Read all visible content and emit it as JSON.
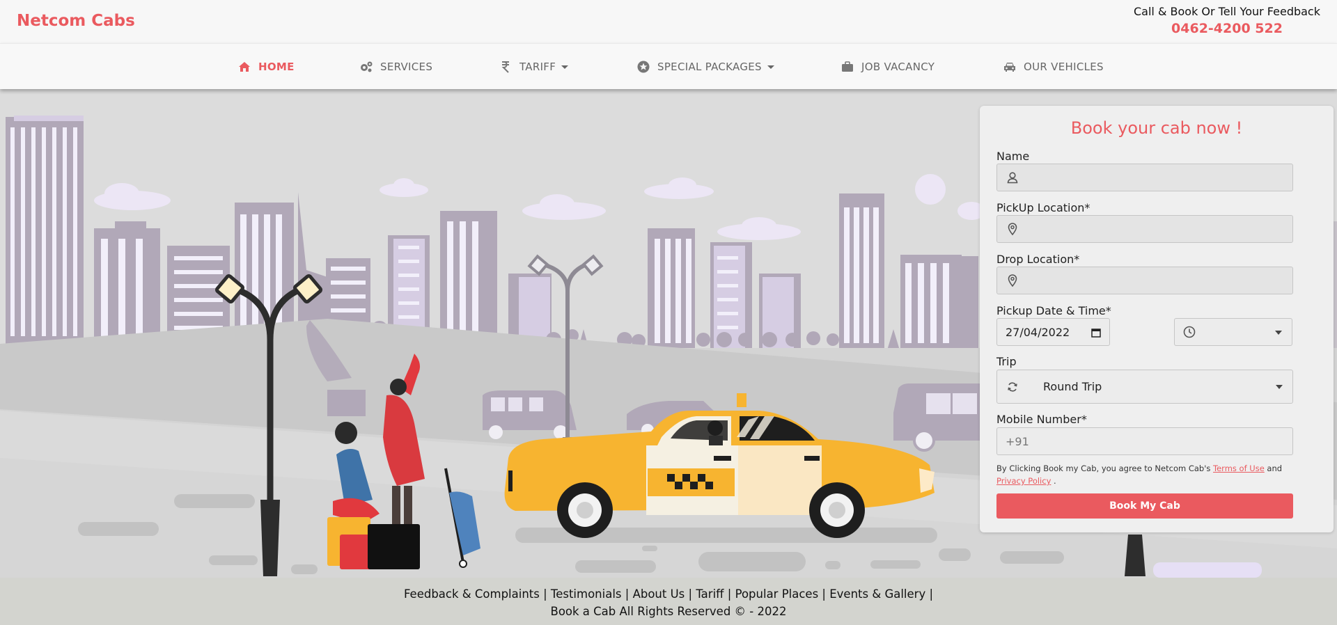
{
  "header": {
    "brand": "Netcom Cabs",
    "contact_line": "Call & Book Or Tell Your Feedback",
    "phone": "0462-4200 522"
  },
  "nav": {
    "items": [
      {
        "label": "HOME",
        "icon": "home-icon",
        "active": true
      },
      {
        "label": "SERVICES",
        "icon": "cogs-icon"
      },
      {
        "label": "TARIFF",
        "icon": "rupee-icon",
        "dropdown": true
      },
      {
        "label": "SPECIAL PACKAGES",
        "icon": "star-icon",
        "dropdown": true
      },
      {
        "label": "JOB VACANCY",
        "icon": "briefcase-icon"
      },
      {
        "label": "OUR VEHICLES",
        "icon": "car-icon"
      }
    ]
  },
  "booking": {
    "title": "Book your cab now !",
    "name_label": "Name",
    "pickup_label": "PickUp Location*",
    "drop_label": "Drop Location*",
    "datetime_label": "Pickup Date & Time*",
    "date_value": "27/04/2022",
    "trip_label": "Trip",
    "trip_value": "Round Trip",
    "mobile_label": "Mobile Number*",
    "mobile_placeholder": "+91",
    "terms_prefix": "By Clicking Book my Cab, you agree to Netcom Cab's ",
    "terms_link": "Terms of Use",
    "terms_and": " and",
    "privacy_link": "Privacy Policy",
    "terms_suffix": " .",
    "button_label": "Book My Cab"
  },
  "footer": {
    "links": [
      "Feedback & Complaints",
      "Testimonials",
      "About Us",
      "Tariff",
      "Popular Places",
      "Events & Gallery"
    ],
    "separator": " | ",
    "trailing": " |",
    "copyright": "Book a Cab All Rights Reserved © - 2022"
  },
  "colors": {
    "accent": "#ea5a5f",
    "taxi": "#f7b430",
    "building": "#b1a8b8",
    "window": "#f2effa",
    "road": "#c9c9c9"
  }
}
